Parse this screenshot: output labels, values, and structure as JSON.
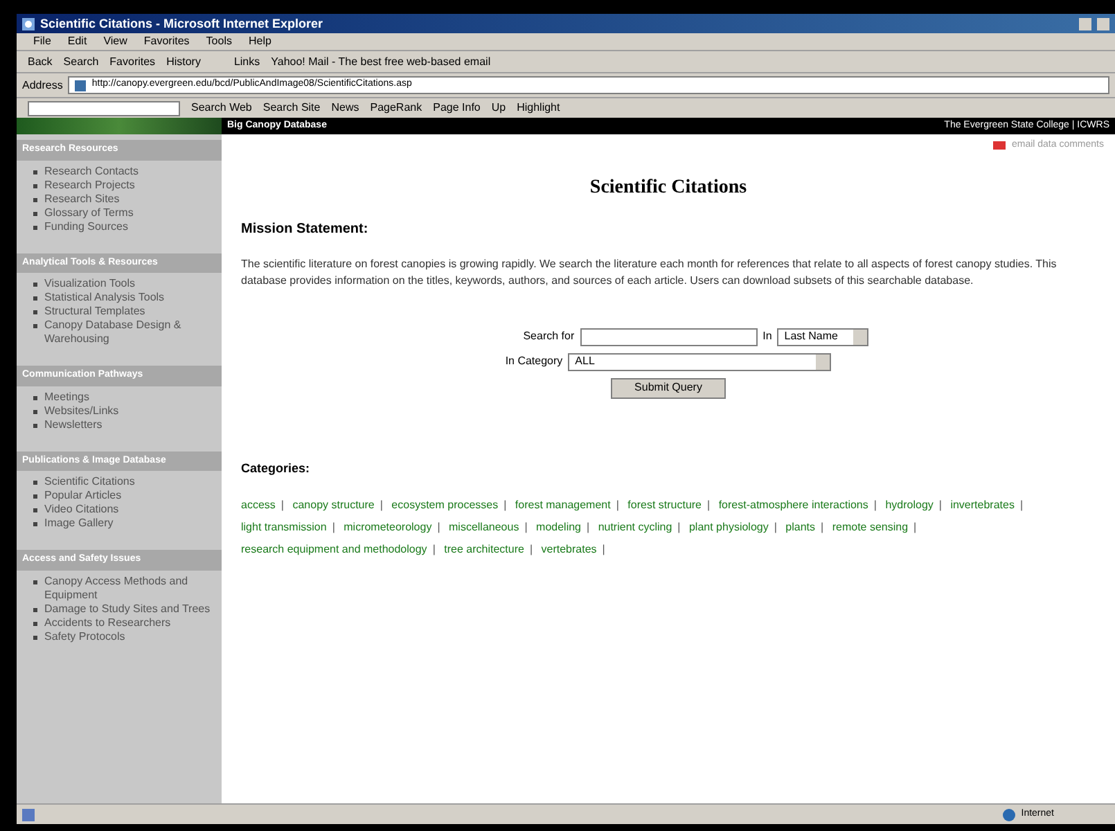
{
  "window": {
    "title": "Scientific Citations - Microsoft Internet Explorer"
  },
  "menu": [
    "File",
    "Edit",
    "View",
    "Favorites",
    "Tools",
    "Help"
  ],
  "toolbar": {
    "back": "Back",
    "buttons": [
      "Search",
      "Favorites",
      "History"
    ],
    "links_label": "Links",
    "link": "Yahoo! Mail - The best free web-based email"
  },
  "address_bar": {
    "label": "Address",
    "value": "http://canopy.evergreen.edu/bcd/PublicAndImage08/ScientificCitations.asp"
  },
  "google_bar": {
    "buttons": [
      "Search Web",
      "Search Site",
      "News",
      "PageRank",
      "Page Info",
      "Up",
      "Highlight"
    ]
  },
  "site_header": {
    "title": "Big Canopy Database",
    "right": "The Evergreen State College | ICWRS",
    "feedback": "email data comments"
  },
  "sidebar": [
    {
      "heading": "Research Resources",
      "items": [
        "Research Contacts",
        "Research Projects",
        "Research Sites",
        "Glossary of Terms",
        "Funding Sources"
      ]
    },
    {
      "heading": "Analytical Tools & Resources",
      "items": [
        "Visualization Tools",
        "Statistical Analysis Tools",
        "Structural Templates",
        "Canopy Database Design & Warehousing"
      ]
    },
    {
      "heading": "Communication Pathways",
      "items": [
        "Meetings",
        "Websites/Links",
        "Newsletters"
      ]
    },
    {
      "heading": "Publications & Image Database",
      "items": [
        "Scientific Citations",
        "Popular Articles",
        "Video Citations",
        "Image Gallery"
      ]
    },
    {
      "heading": "Access and Safety Issues",
      "items": [
        "Canopy Access Methods and Equipment",
        "Damage to Study Sites and Trees",
        "Accidents to Researchers",
        "Safety Protocols"
      ]
    }
  ],
  "main": {
    "title": "Scientific Citations",
    "mission_heading": "Mission Statement:",
    "mission_text": "The scientific literature on forest canopies is growing rapidly. We search the literature each month for references that relate to all aspects of forest canopy studies. This database provides information on the titles, keywords, authors, and sources of each article. Users can download subsets of this searchable database.",
    "search": {
      "label": "Search for",
      "in_label": "In",
      "in_value": "Last Name",
      "category_label": "In Category",
      "category_value": "ALL",
      "submit": "Submit Query"
    },
    "categories_heading": "Categories:",
    "category_separator": "|",
    "categories": [
      "access",
      "canopy structure",
      "ecosystem processes",
      "forest management",
      "forest structure",
      "forest-atmosphere interactions",
      "hydrology",
      "invertebrates",
      "light transmission",
      "micrometeorology",
      "miscellaneous",
      "modeling",
      "nutrient cycling",
      "plant physiology",
      "plants",
      "remote sensing",
      "research equipment and methodology",
      "tree architecture",
      "vertebrates"
    ]
  },
  "status_bar": {
    "zone": "Internet"
  }
}
